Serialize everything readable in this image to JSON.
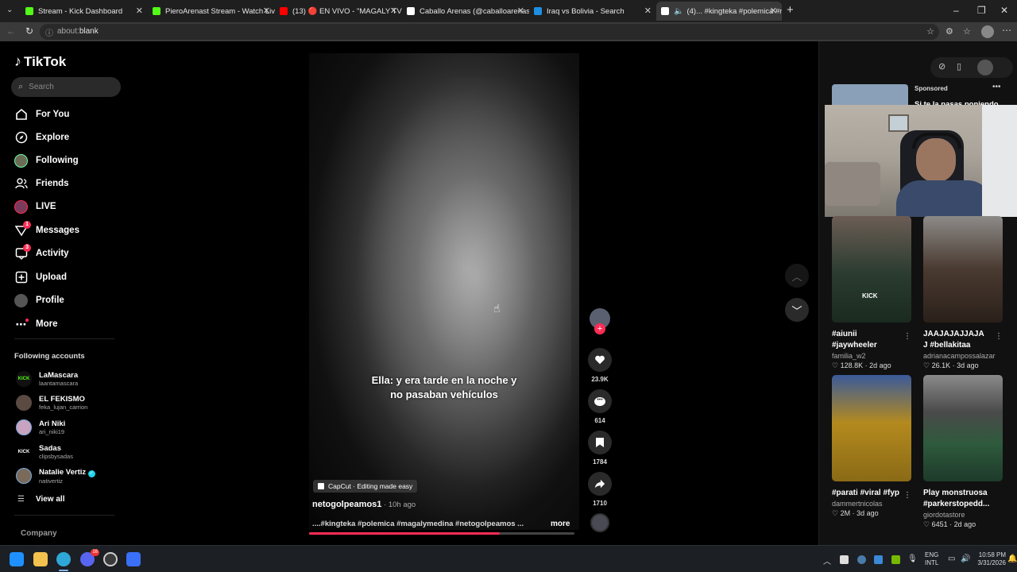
{
  "browser": {
    "tabs": [
      {
        "title": "Stream - Kick Dashboard",
        "fav": "#53fc18"
      },
      {
        "title": "PieroArenast Stream - Watch Live",
        "fav": "#53fc18"
      },
      {
        "title": "(13) 🔴 EN VIVO - \"MAGALY TV LA",
        "fav": "#ff0000"
      },
      {
        "title": "Caballo Arenas (@caballoarenas) |",
        "fav": "#ffffff"
      },
      {
        "title": "Iraq vs Bolivia - Search",
        "fav": "#1d8fe1"
      },
      {
        "title": "(4)... #kingteka #polemica #r",
        "fav": "#ffffff"
      }
    ],
    "url_scheme": "about:",
    "url_path": "blank"
  },
  "sidebar": {
    "logo": "TikTok",
    "search_placeholder": "Search",
    "nav": [
      {
        "label": "For You",
        "icon": "home-icon"
      },
      {
        "label": "Explore",
        "icon": "compass-icon"
      },
      {
        "label": "Following",
        "icon": "following-avatar-icon"
      },
      {
        "label": "Friends",
        "icon": "friends-icon"
      },
      {
        "label": "LIVE",
        "icon": "live-icon"
      },
      {
        "label": "Messages",
        "icon": "messages-icon",
        "badge": "1"
      },
      {
        "label": "Activity",
        "icon": "activity-icon",
        "badge": "3"
      },
      {
        "label": "Upload",
        "icon": "upload-icon"
      },
      {
        "label": "Profile",
        "icon": "profile-avatar-icon"
      },
      {
        "label": "More",
        "icon": "more-icon"
      }
    ],
    "following_title": "Following accounts",
    "accounts": [
      {
        "name": "LaMascara",
        "handle": "laantamascara"
      },
      {
        "name": "EL FEKISMO",
        "handle": "feka_lujan_carrion"
      },
      {
        "name": "Ari Niki",
        "handle": "ari_niki19"
      },
      {
        "name": "Sadas",
        "handle": "clipsbysadas"
      },
      {
        "name": "Natalie Vertiz",
        "handle": "nativertiz"
      }
    ],
    "view_all": "View all",
    "company": "Company"
  },
  "video": {
    "subtitle_line1": "Ella: y era tarde en la noche y",
    "subtitle_line2": "no pasaban vehículos",
    "capcut": "CapCut · Editing made easy",
    "author": "netogolpeamos1",
    "time": " · 10h ago",
    "description": "....#kingteka #polemica #magalymedina #netogolpeamos ...",
    "more": "more",
    "likes": "23.9K",
    "comments": "614",
    "saves": "1784",
    "shares": "1710",
    "progress": 0.72
  },
  "right": {
    "sponsored": "Sponsored",
    "sponsored_text": "Si te la pasas poniendo",
    "cards": [
      {
        "caption1": "#aiunii",
        "caption2": "#jaywheeler",
        "user": "familia_w2",
        "likes": "128.8K",
        "age": "2d ago",
        "color": "#2a3b2f",
        "overlay": "KICK"
      },
      {
        "caption1": "JAAJAJAJJAJA",
        "caption2": "J #bellakitaa",
        "user": "adrianacampossalazar",
        "likes": "26.1K",
        "age": "3d ago",
        "color": "#4a3a30",
        "overlay": ""
      },
      {
        "caption1": "#parati #viral #fyp",
        "caption2": "",
        "user": "dammertnicolas",
        "likes": "2M",
        "age": "3d ago",
        "color": "#b48a1e",
        "overlay": ""
      },
      {
        "caption1": "Play monstruosa",
        "caption2": "#parkerstopedd...",
        "user": "giordotastore",
        "likes": "6451",
        "age": "2d ago",
        "color": "#2e5a3c",
        "overlay": ""
      }
    ]
  },
  "taskbar": {
    "lang1": "ENG",
    "lang2": "INTL",
    "time": "10:58 PM",
    "date": "3/31/2026",
    "discord_badge": "16"
  }
}
